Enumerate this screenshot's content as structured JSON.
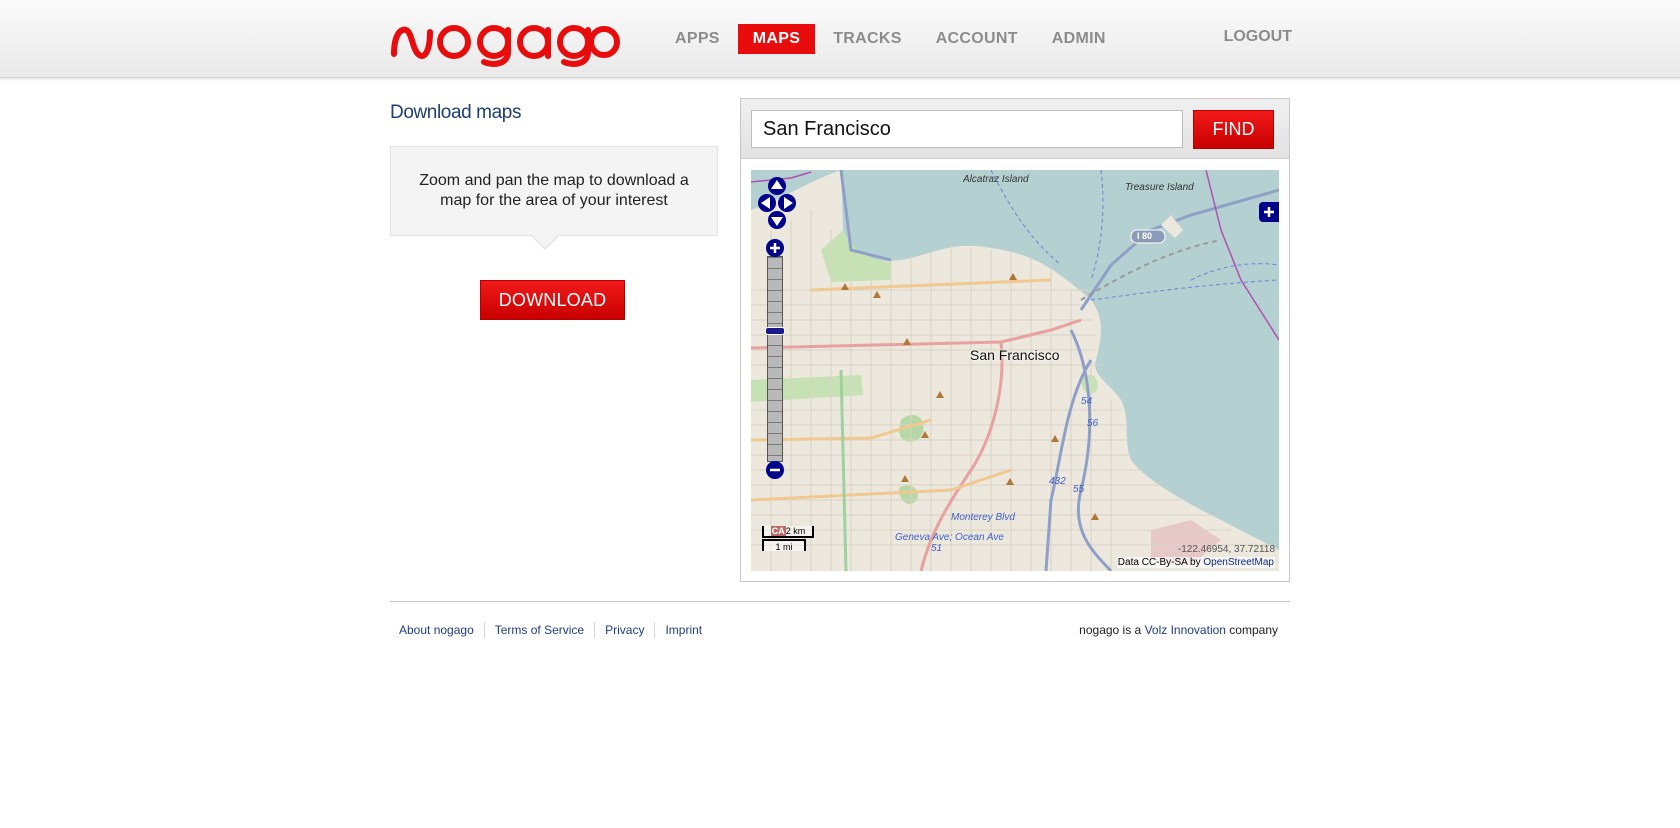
{
  "brand": {
    "logo_text": "nogago",
    "accent_color": "#e90c0c",
    "title_color": "#1c3f74"
  },
  "nav": {
    "items": [
      {
        "label": "APPS"
      },
      {
        "label": "MAPS",
        "active": true
      },
      {
        "label": "TRACKS"
      },
      {
        "label": "ACCOUNT"
      },
      {
        "label": "ADMIN"
      }
    ],
    "logout_label": "LOGOUT"
  },
  "left": {
    "title": "Download maps",
    "hint": "Zoom and pan the map to download a map for the area of your interest",
    "download_label": "DOWNLOAD"
  },
  "search": {
    "value": "San Francisco",
    "find_label": "FIND"
  },
  "map": {
    "city_label": "San Francisco",
    "labels": {
      "alcatraz": "Alcatraz Island",
      "treasure": "Treasure Island",
      "highway": "I 80",
      "monterey": "Monterey Blvd",
      "geneva": "Geneva Ave; Ocean Ave",
      "route_56": "56",
      "route_432": "432",
      "route_55": "55",
      "route_51": "51",
      "route_54": "54"
    },
    "scale_km": "2 km",
    "scale_mi": "1 mi",
    "scale_badge": "CA",
    "coordinates": "-122.46954, 37.72118",
    "attribution_prefix": "Data CC-By-SA by ",
    "attribution_link": "OpenStreetMap",
    "icons": {
      "pan_up": "arrow-up-icon",
      "pan_left": "arrow-left-icon",
      "pan_right": "arrow-right-icon",
      "pan_down": "arrow-down-icon",
      "zoom_in": "plus-icon",
      "zoom_out": "minus-icon",
      "layers": "plus-icon"
    },
    "control_color": "#00008b"
  },
  "footer": {
    "links": [
      {
        "label": "About nogago"
      },
      {
        "label": "Terms of Service"
      },
      {
        "label": "Privacy"
      },
      {
        "label": "Imprint"
      }
    ],
    "company_prefix": "nogago is a ",
    "company_link": "Volz Innovation",
    "company_suffix": " company"
  }
}
